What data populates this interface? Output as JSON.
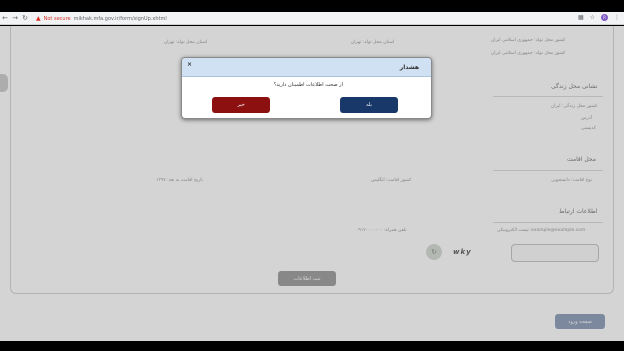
{
  "browser": {
    "url_warning": "Not secure",
    "url": "mikhak.mfa.gov.ir/form/signUp.xhtml",
    "back_icon": "arrow-left",
    "forward_icon": "arrow-right",
    "reload_icon": "reload",
    "profile_initial": "R"
  },
  "form": {
    "row_top_left": "کشور محل تولد: جمهوری اسلامی ایران",
    "row_top_mid": "استان محل تولد: تهران",
    "row_top_right": "کشور محل تولد: جمهوری اسلامی ایران",
    "row_top_right2": "شهر محل تولد: تهران",
    "section_life_address": "نشانی محل زندگی",
    "life_country": "کشور محل زندگی: ایران",
    "life_line2": "آدرس",
    "life_line3": "کدپستی",
    "section_residence": "محل اقامت",
    "residence_type": "نوع اقامت: دانشجویی",
    "residence_country": "کشور اقامت: انگلیس",
    "residence_date": "تاریخ اقامت به بعد: ۱۳۹۷",
    "section_contact": "اطلاعات ارتباط",
    "contact_email": "پست الکترونیکی: example@example.com",
    "contact_mobile": "تلفن همراه: ۰۹۱۲۰۰۰۰۰۰۰",
    "captcha_text": "wky",
    "register_button": "ثبت اطلاعات",
    "back_button": "صفحه ورود"
  },
  "dialog": {
    "title": "هشدار",
    "message": "از صحت اطلاعات اطمینان دارید؟",
    "yes_label": "بله",
    "no_label": "خیر",
    "close_symbol": "×"
  }
}
